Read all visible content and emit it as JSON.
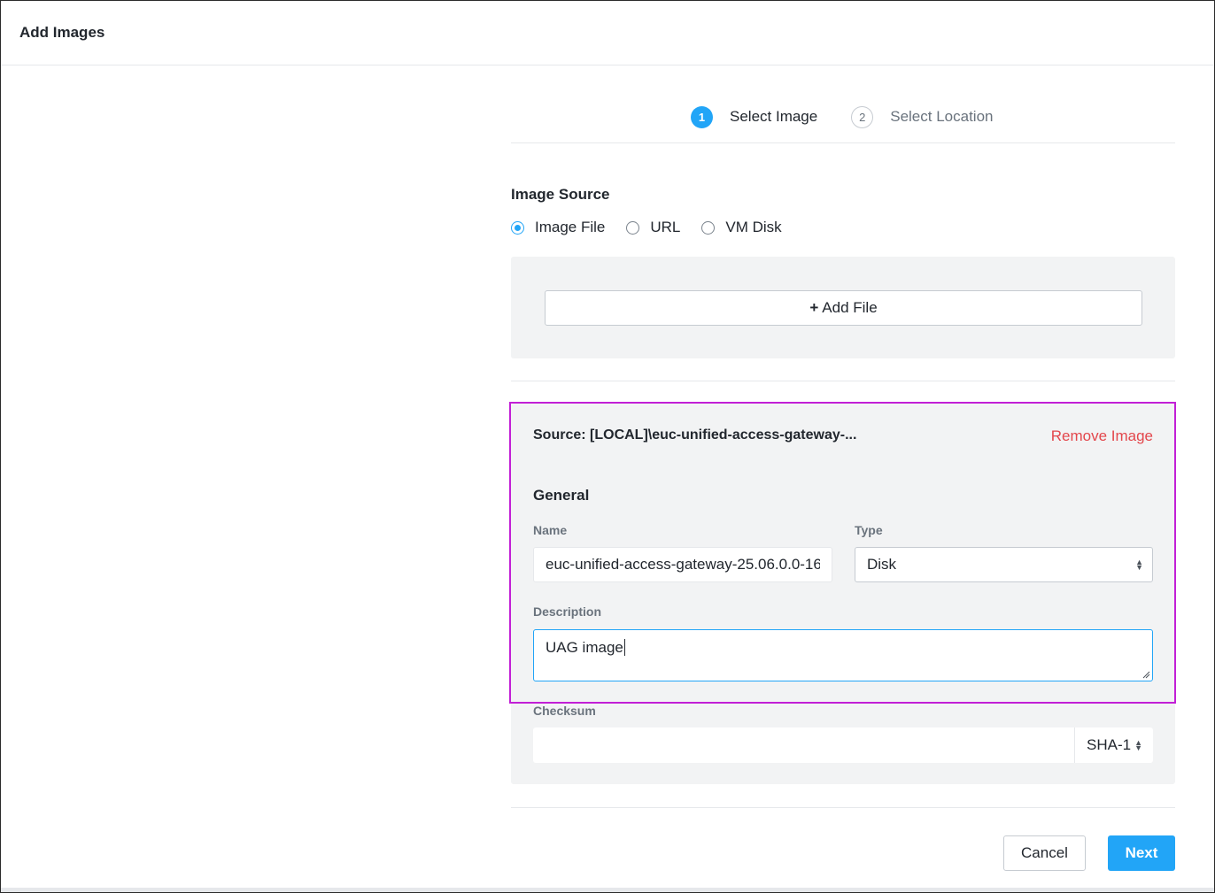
{
  "dialog": {
    "title": "Add Images"
  },
  "steps": [
    {
      "number": "1",
      "label": "Select Image",
      "active": true
    },
    {
      "number": "2",
      "label": "Select Location",
      "active": false
    }
  ],
  "image_source": {
    "title": "Image Source",
    "options": [
      {
        "label": "Image File",
        "checked": true
      },
      {
        "label": "URL",
        "checked": false
      },
      {
        "label": "VM Disk",
        "checked": false
      }
    ],
    "add_file_plus": "+",
    "add_file_label": "Add File"
  },
  "image_entry": {
    "source_text": "Source: [LOCAL]\\euc-unified-access-gateway-...",
    "remove_label": "Remove Image",
    "general_title": "General",
    "name_label": "Name",
    "name_value": "euc-unified-access-gateway-25.06.0.0-16",
    "type_label": "Type",
    "type_value": "Disk",
    "description_label": "Description",
    "description_value": "UAG image",
    "checksum_label": "Checksum",
    "checksum_value": "",
    "checksum_algorithm": "SHA-1"
  },
  "footer": {
    "cancel_label": "Cancel",
    "next_label": "Next"
  },
  "colors": {
    "accent": "#22a5f7",
    "danger": "#e3474c",
    "highlight": "#c21fd6",
    "panel": "#f2f3f4"
  }
}
